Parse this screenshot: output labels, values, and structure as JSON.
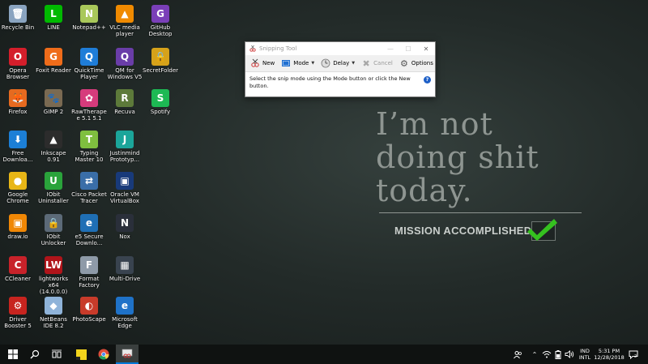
{
  "desktop_icons": [
    {
      "label": "Recycle Bin",
      "icon": "recycle-bin-icon",
      "color": "#8aa4c0",
      "glyph": "🗑"
    },
    {
      "label": "Opera Browser",
      "icon": "opera-icon",
      "color": "#d41e2b",
      "glyph": "O"
    },
    {
      "label": "Firefox",
      "icon": "firefox-icon",
      "color": "#e66a1f",
      "glyph": "🦊"
    },
    {
      "label": "Free Downloa...",
      "icon": "free-download-manager-icon",
      "color": "#1c7fd6",
      "glyph": "⬇"
    },
    {
      "label": "Google Chrome",
      "icon": "chrome-icon",
      "color": "#e8b616",
      "glyph": "●"
    },
    {
      "label": "draw.io",
      "icon": "drawio-icon",
      "color": "#f08705",
      "glyph": "▣"
    },
    {
      "label": "CCleaner",
      "icon": "ccleaner-icon",
      "color": "#c8222a",
      "glyph": "C"
    },
    {
      "label": "Driver Booster 5",
      "icon": "driver-booster-icon",
      "color": "#c7241f",
      "glyph": "⚙"
    },
    {
      "label": "LINE",
      "icon": "line-icon",
      "color": "#00b900",
      "glyph": "L"
    },
    {
      "label": "Foxit Reader",
      "icon": "foxit-icon",
      "color": "#ef6c1a",
      "glyph": "G"
    },
    {
      "label": "GIMP 2",
      "icon": "gimp-icon",
      "color": "#7a6a52",
      "glyph": "🐾"
    },
    {
      "label": "Inkscape 0.91",
      "icon": "inkscape-icon",
      "color": "#2c2c2c",
      "glyph": "▲"
    },
    {
      "label": "IObit Uninstaller",
      "icon": "iobit-uninstaller-icon",
      "color": "#2aa33b",
      "glyph": "U"
    },
    {
      "label": "IObit Unlocker",
      "icon": "iobit-unlocker-icon",
      "color": "#5c6a78",
      "glyph": "🔒"
    },
    {
      "label": "lightworks x64 (14.0.0.0)",
      "icon": "lightworks-icon",
      "color": "#b0141a",
      "glyph": "LW"
    },
    {
      "label": "NetBeans IDE 8.2",
      "icon": "netbeans-icon",
      "color": "#8fb3d9",
      "glyph": "◆"
    },
    {
      "label": "Notepad++",
      "icon": "notepadpp-icon",
      "color": "#a9c85a",
      "glyph": "N"
    },
    {
      "label": "QuickTime Player",
      "icon": "quicktime-icon",
      "color": "#1f7dd8",
      "glyph": "Q"
    },
    {
      "label": "RawTherapee 5.1 5.1",
      "icon": "rawtherapee-icon",
      "color": "#d63b7c",
      "glyph": "✿"
    },
    {
      "label": "Typing Master 10",
      "icon": "typing-master-icon",
      "color": "#7fbf3f",
      "glyph": "T"
    },
    {
      "label": "Cisco Packet Tracer",
      "icon": "cisco-packet-tracer-icon",
      "color": "#3a6ea8",
      "glyph": "⇄"
    },
    {
      "label": "e5 Secure Downlo...",
      "icon": "secure-download-icon",
      "color": "#1f6fb5",
      "glyph": "e"
    },
    {
      "label": "Format Factory",
      "icon": "format-factory-icon",
      "color": "#8e9aa8",
      "glyph": "F"
    },
    {
      "label": "PhotoScape",
      "icon": "photoscape-icon",
      "color": "#c83b2a",
      "glyph": "◐"
    },
    {
      "label": "VLC media player",
      "icon": "vlc-icon",
      "color": "#f08a00",
      "glyph": "▲"
    },
    {
      "label": "QM for Windows V5",
      "icon": "qm-windows-icon",
      "color": "#6a3da8",
      "glyph": "Q"
    },
    {
      "label": "Recuva",
      "icon": "recuva-icon",
      "color": "#5d7a3a",
      "glyph": "R"
    },
    {
      "label": "Justinmind Prototyp...",
      "icon": "justinmind-icon",
      "color": "#1ba59a",
      "glyph": "J"
    },
    {
      "label": "Oracle VM VirtualBox",
      "icon": "virtualbox-icon",
      "color": "#183a7a",
      "glyph": "▣"
    },
    {
      "label": "Nox",
      "icon": "nox-icon",
      "color": "#2a2f3a",
      "glyph": "N"
    },
    {
      "label": "Multi-Drive",
      "icon": "multi-drive-icon",
      "color": "#39434f",
      "glyph": "▦"
    },
    {
      "label": "Microsoft Edge",
      "icon": "edge-icon",
      "color": "#1f72c8",
      "glyph": "e"
    },
    {
      "label": "GitHub Desktop",
      "icon": "github-desktop-icon",
      "color": "#7a3fb8",
      "glyph": "G"
    },
    {
      "label": "SecretFolder",
      "icon": "secret-folder-icon",
      "color": "#d6a21a",
      "glyph": "🔒"
    },
    {
      "label": "Spotify",
      "icon": "spotify-icon",
      "color": "#1db954",
      "glyph": "S"
    }
  ],
  "wallpaper": {
    "line1": "I’m not",
    "line2": "doing shit",
    "line3": "today.",
    "tagline": "MISSION ACCOMPLISHED",
    "check_color": "#35c11f"
  },
  "snipping_tool": {
    "title": "Snipping Tool",
    "toolbar": {
      "new": "New",
      "mode": "Mode",
      "delay": "Delay",
      "cancel": "Cancel",
      "options": "Options"
    },
    "message": "Select the snip mode using the Mode button or click the New button.",
    "help": "?"
  },
  "taskbar": {
    "lang_line1": "IND",
    "lang_line2": "INTL",
    "time": "5:31 PM",
    "date": "12/28/2018",
    "notifications": "2",
    "accent": "#0078d7"
  }
}
